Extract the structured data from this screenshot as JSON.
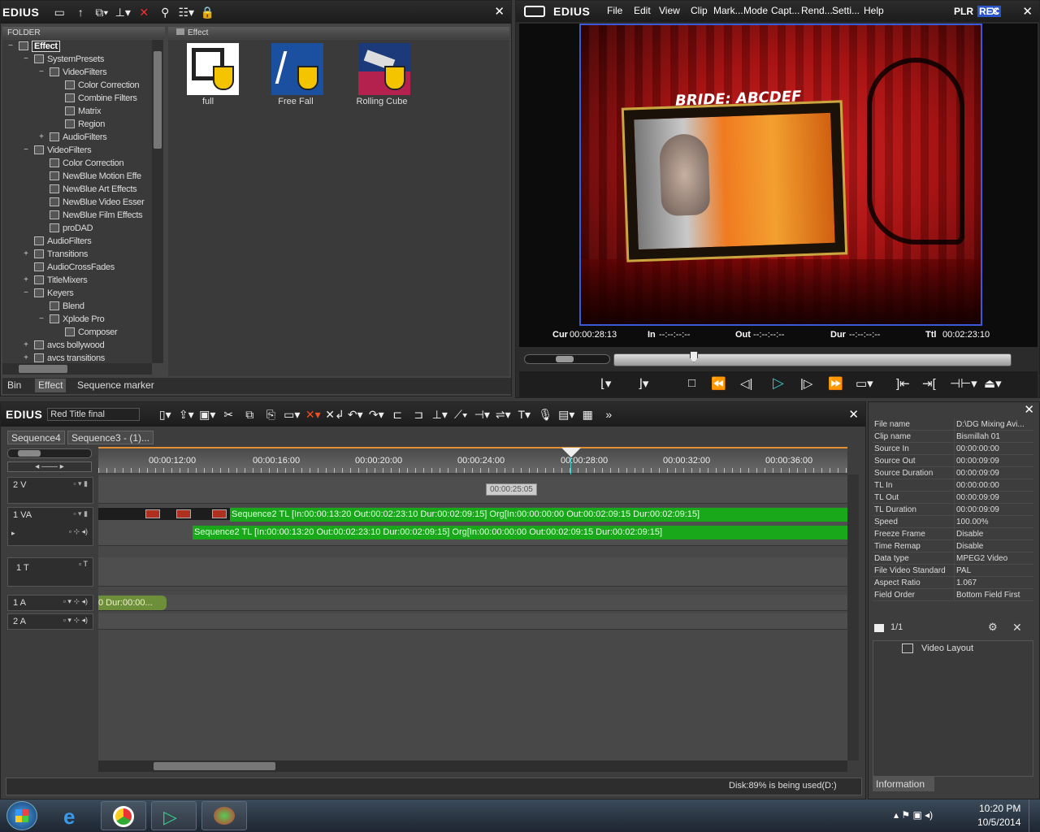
{
  "bin_window": {
    "logo": "EDIUS",
    "folder_header": "FOLDER",
    "content_header": "Effect",
    "tree": [
      {
        "label": "Effect",
        "level": 0,
        "expander": "−",
        "selected": true
      },
      {
        "label": "SystemPresets",
        "level": 1,
        "expander": "−"
      },
      {
        "label": "VideoFilters",
        "level": 2,
        "expander": "−"
      },
      {
        "label": "Color Correction",
        "level": 3,
        "expander": ""
      },
      {
        "label": "Combine Filters",
        "level": 3,
        "expander": ""
      },
      {
        "label": "Matrix",
        "level": 3,
        "expander": ""
      },
      {
        "label": "Region",
        "level": 3,
        "expander": ""
      },
      {
        "label": "AudioFilters",
        "level": 2,
        "expander": "+"
      },
      {
        "label": "VideoFilters",
        "level": 1,
        "expander": "−"
      },
      {
        "label": "Color Correction",
        "level": 2,
        "expander": ""
      },
      {
        "label": "NewBlue Motion Effe",
        "level": 2,
        "expander": ""
      },
      {
        "label": "NewBlue Art Effects",
        "level": 2,
        "expander": ""
      },
      {
        "label": "NewBlue Video Esser",
        "level": 2,
        "expander": ""
      },
      {
        "label": "NewBlue Film Effects",
        "level": 2,
        "expander": ""
      },
      {
        "label": "proDAD",
        "level": 2,
        "expander": ""
      },
      {
        "label": "AudioFilters",
        "level": 1,
        "expander": ""
      },
      {
        "label": "Transitions",
        "level": 1,
        "expander": "+"
      },
      {
        "label": "AudioCrossFades",
        "level": 1,
        "expander": ""
      },
      {
        "label": "TitleMixers",
        "level": 1,
        "expander": "+"
      },
      {
        "label": "Keyers",
        "level": 1,
        "expander": "−"
      },
      {
        "label": "Blend",
        "level": 2,
        "expander": ""
      },
      {
        "label": "Xplode Pro",
        "level": 2,
        "expander": "−"
      },
      {
        "label": "Composer",
        "level": 3,
        "expander": ""
      },
      {
        "label": "avcs bollywood",
        "level": 1,
        "expander": "+"
      },
      {
        "label": "avcs transitions",
        "level": 1,
        "expander": "+"
      }
    ],
    "effects": [
      {
        "label": "full"
      },
      {
        "label": "Free Fall"
      },
      {
        "label": "Rolling Cube"
      }
    ],
    "tabs": [
      "Bin",
      "Effect",
      "Sequence marker"
    ]
  },
  "player": {
    "logo": "EDIUS",
    "menu": [
      "File",
      "Edit",
      "View",
      "Clip",
      "Mark...",
      "Mode",
      "Capt...",
      "Rend...",
      "Setti...",
      "Help"
    ],
    "plr": "PLR",
    "rec": "REC",
    "overlay_title": "BRIDE: ABCDEF",
    "cur_label": "Cur",
    "cur_value": "00:00:28:13",
    "in_label": "In",
    "in_value": "--:--:--:--",
    "out_label": "Out",
    "out_value": "--:--:--:--",
    "dur_label": "Dur",
    "dur_value": "--:--:--:--",
    "ttl_label": "Ttl",
    "ttl_value": "00:02:23:10"
  },
  "timeline": {
    "logo": "EDIUS",
    "project_name": "Red Title final",
    "tabs": [
      "Sequence4",
      "Sequence3 - (1)..."
    ],
    "ruler": [
      "00:00:12:00",
      "00:00:16:00",
      "00:00:20:00",
      "00:00:24:00",
      "00:00:28:00",
      "00:00:32:00",
      "00:00:36:00"
    ],
    "cursor_tooltip": "00:00:25:05",
    "tracks": [
      {
        "label": "2 V"
      },
      {
        "label": "1 VA"
      },
      {
        "label": "1 T"
      },
      {
        "label": "1 A"
      },
      {
        "label": "2 A"
      }
    ],
    "clip_1": "Sequence2  TL [In:00:00:13:20  Out:00:02:23:10  Dur:00:02:09:15]  Org[In:00:00:00:00  Out:00:02:09:15  Dur:00:02:09:15]",
    "clip_2": "Sequence2  TL [In:00:00:13:20  Out:00:02:23:10  Dur:00:02:09:15]  Org[In:00:00:00:00  Out:00:02:09:15  Dur:00:02:09:15]",
    "audio_clip": "0 Dur:00:00...",
    "status": "Disk:89% is being used(D:)"
  },
  "info_panel": {
    "rows": [
      {
        "key": "File name",
        "value": "D:\\DG Mixing Avi..."
      },
      {
        "key": "Clip name",
        "value": "Bismillah 01"
      },
      {
        "key": "Source In",
        "value": "00:00:00:00"
      },
      {
        "key": "Source Out",
        "value": "00:00:09:09"
      },
      {
        "key": "Source Duration",
        "value": "00:00:09:09"
      },
      {
        "key": "TL In",
        "value": "00:00:00:00"
      },
      {
        "key": "TL Out",
        "value": "00:00:09:09"
      },
      {
        "key": "TL Duration",
        "value": "00:00:09:09"
      },
      {
        "key": "Speed",
        "value": "100.00%"
      },
      {
        "key": "Freeze Frame",
        "value": "Disable"
      },
      {
        "key": "Time Remap",
        "value": "Disable"
      },
      {
        "key": "Data type",
        "value": "MPEG2 Video"
      },
      {
        "key": "File Video Standard",
        "value": "PAL"
      },
      {
        "key": "Aspect Ratio",
        "value": "1.067"
      },
      {
        "key": "Field Order",
        "value": "Bottom Field First"
      }
    ],
    "page": "1/1",
    "layout_item": "Video Layout",
    "tab": "Information"
  },
  "taskbar": {
    "time": "10:20 PM",
    "date": "10/5/2014"
  }
}
